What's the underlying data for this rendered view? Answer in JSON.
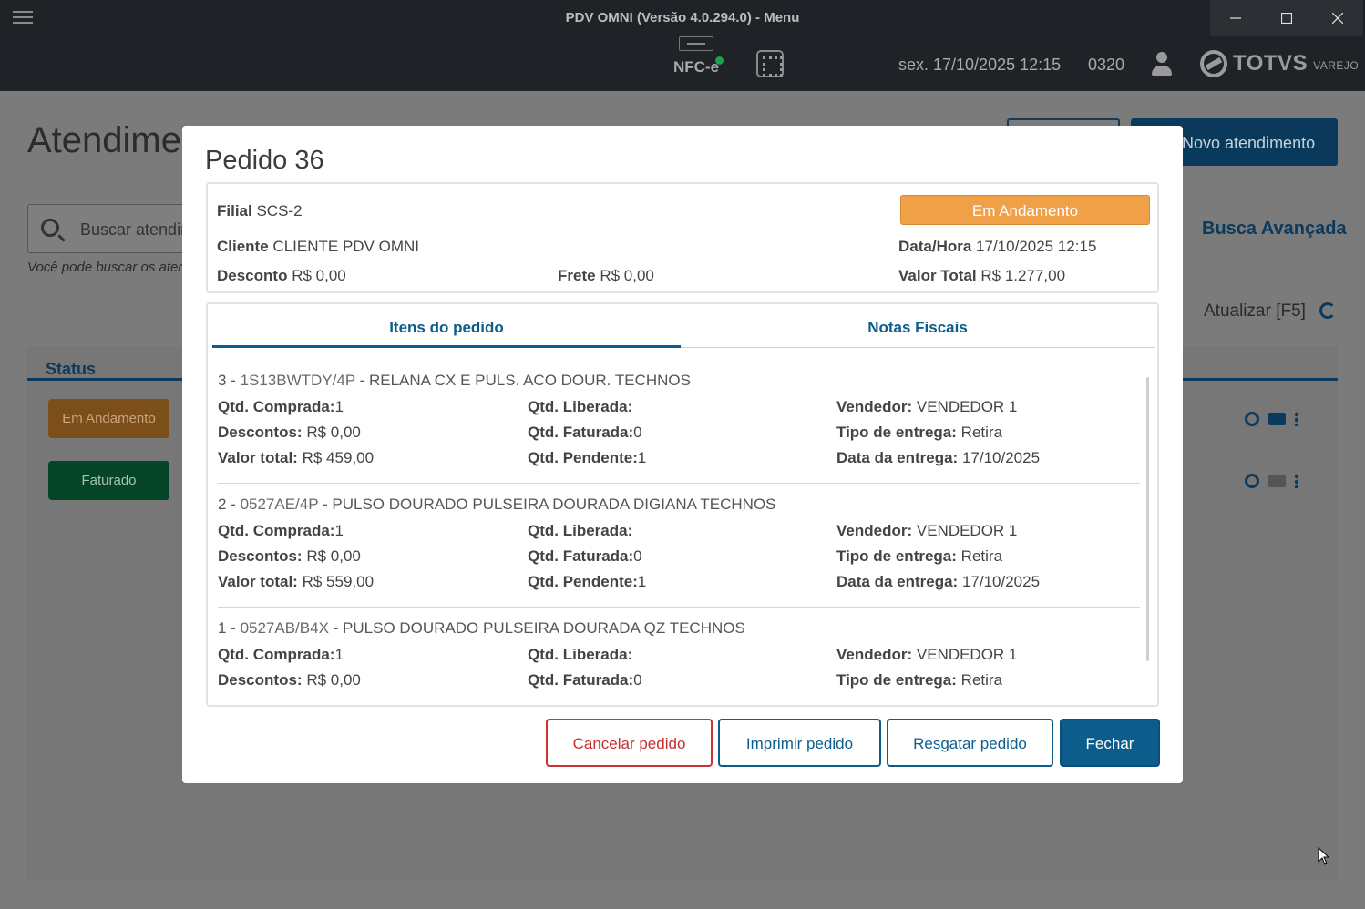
{
  "window": {
    "title": "PDV OMNI (Versão 4.0.294.0) - Menu",
    "nfce_label": "NFC-e",
    "datetime": "sex. 17/10/2025 12:15",
    "terminal": "0320",
    "brand": "TOTVS",
    "brand_sub": "VAREJO"
  },
  "background": {
    "title": "Atendime",
    "search_placeholder": "Buscar atendin",
    "search_hint": "Você pode buscar os ater",
    "new_button": "Novo atendimento",
    "advanced_search": "Busca Avançada",
    "refresh": "Atualizar [F5]",
    "status_header": "Status",
    "rows": [
      {
        "status": "Em Andamento"
      },
      {
        "status": "Faturado"
      }
    ]
  },
  "modal": {
    "title": "Pedido 36",
    "status": "Em Andamento",
    "status_color": "#f0a046",
    "filial_label": "Filial",
    "filial": "SCS-2",
    "cliente_label": "Cliente",
    "cliente": "CLIENTE PDV OMNI",
    "datahora_label": "Data/Hora",
    "datahora": "17/10/2025 12:15",
    "desconto_label": "Desconto",
    "desconto": "R$ 0,00",
    "frete_label": "Frete",
    "frete": "R$ 0,00",
    "valor_total_label": "Valor Total",
    "valor_total": "R$ 1.277,00",
    "tabs": [
      {
        "label": "Itens do pedido",
        "active": true
      },
      {
        "label": "Notas Fiscais",
        "active": false
      }
    ],
    "labels": {
      "qtd_comprada": "Qtd. Comprada:",
      "qtd_liberada": "Qtd. Liberada:",
      "vendedor": "Vendedor:",
      "descontos": "Descontos:",
      "qtd_faturada": "Qtd. Faturada:",
      "tipo_entrega": "Tipo de entrega:",
      "valor_total": "Valor total:",
      "qtd_pendente": "Qtd. Pendente:",
      "data_entrega": "Data da entrega:"
    },
    "items": [
      {
        "seq": "3 - ",
        "code": "1S13BWTDY/4P",
        "sep": " - ",
        "desc": "RELANA CX E PULS. ACO DOUR. TECHNOS",
        "qtd_comprada": "1",
        "qtd_liberada": "",
        "vendedor": "VENDEDOR 1",
        "descontos": "R$ 0,00",
        "qtd_faturada": "0",
        "tipo_entrega": "Retira",
        "valor_total": "R$ 459,00",
        "qtd_pendente": "1",
        "data_entrega": "17/10/2025"
      },
      {
        "seq": "2 - ",
        "code": "0527AE/4P",
        "sep": " - ",
        "desc": "PULSO DOURADO PULSEIRA DOURADA DIGIANA TECHNOS",
        "qtd_comprada": "1",
        "qtd_liberada": "",
        "vendedor": "VENDEDOR 1",
        "descontos": "R$ 0,00",
        "qtd_faturada": "0",
        "tipo_entrega": "Retira",
        "valor_total": "R$ 559,00",
        "qtd_pendente": "1",
        "data_entrega": "17/10/2025"
      },
      {
        "seq": "1 - ",
        "code": "0527AB/B4X",
        "sep": " - ",
        "desc": "PULSO DOURADO PULSEIRA DOURADA QZ TECHNOS",
        "qtd_comprada": "1",
        "qtd_liberada": "",
        "vendedor": "VENDEDOR 1",
        "descontos": "R$ 0,00",
        "qtd_faturada": "0",
        "tipo_entrega": "Retira"
      }
    ],
    "buttons": {
      "cancel": "Cancelar pedido",
      "print": "Imprimir pedido",
      "rescue": "Resgatar pedido",
      "close": "Fechar"
    }
  }
}
